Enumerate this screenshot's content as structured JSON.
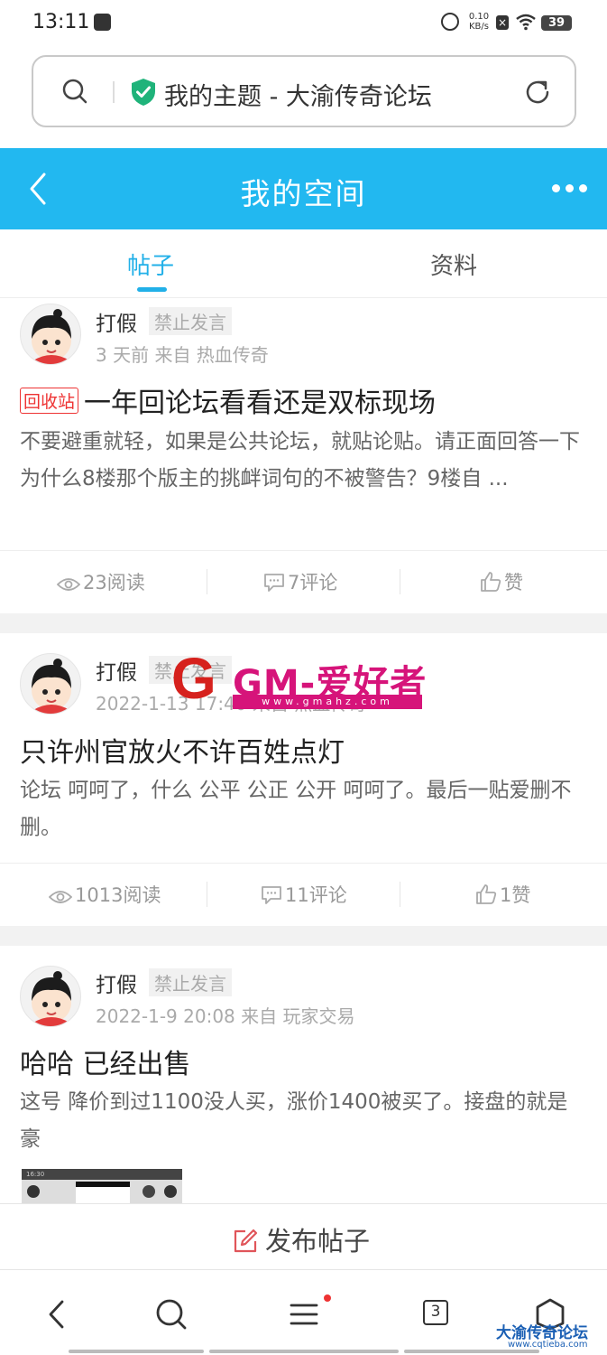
{
  "status": {
    "time": "13:11",
    "speed_value": "0.10",
    "speed_unit": "KB/s",
    "battery": "39"
  },
  "browser": {
    "page_title": "我的主题 - 大渝传奇论坛"
  },
  "header": {
    "title": "我的空间"
  },
  "tabs": [
    {
      "label": "帖子",
      "active": true
    },
    {
      "label": "资料",
      "active": false
    }
  ],
  "posts": [
    {
      "username": "打假",
      "badge": "禁止发言",
      "meta": "3 天前  来自 热血传奇",
      "tag": "回收站",
      "title": "一年回论坛看看还是双标现场",
      "body": "不要避重就轻，如果是公共论坛，就贴论贴。请正面回答一下 为什么8楼那个版主的挑衅词句的不被警告？9楼自 ...",
      "views": "23阅读",
      "comments": "7评论",
      "likes": "赞"
    },
    {
      "username": "打假",
      "badge": "禁止发言",
      "meta": "2022-1-13 17:40  来自 热血传奇",
      "title": "只许州官放火不许百姓点灯",
      "body": "论坛 呵呵了，什么 公平 公正 公开 呵呵了。最后一贴爱删不删。",
      "views": "1013阅读",
      "comments": "11评论",
      "likes": "1赞"
    },
    {
      "username": "打假",
      "badge": "禁止发言",
      "meta": "2022-1-9 20:08  来自 玩家交易",
      "title": "哈哈 已经出售",
      "body": "这号 降价到过1100没人买，涨价1400被买了。接盘的就是豪",
      "thumb_time": "16:30"
    }
  ],
  "watermark": {
    "letter": "G",
    "text": "GM-爱好者",
    "url": "www.gmahz.com"
  },
  "publish": {
    "label": "发布帖子"
  },
  "bottom_nav": {
    "tab_count": "3"
  },
  "brand": {
    "name": "大渝传奇论坛",
    "url": "www.cqtieba.com"
  },
  "colors": {
    "accent": "#22b8f0",
    "tag_red": "#ee3333",
    "watermark": "#d6147a"
  }
}
